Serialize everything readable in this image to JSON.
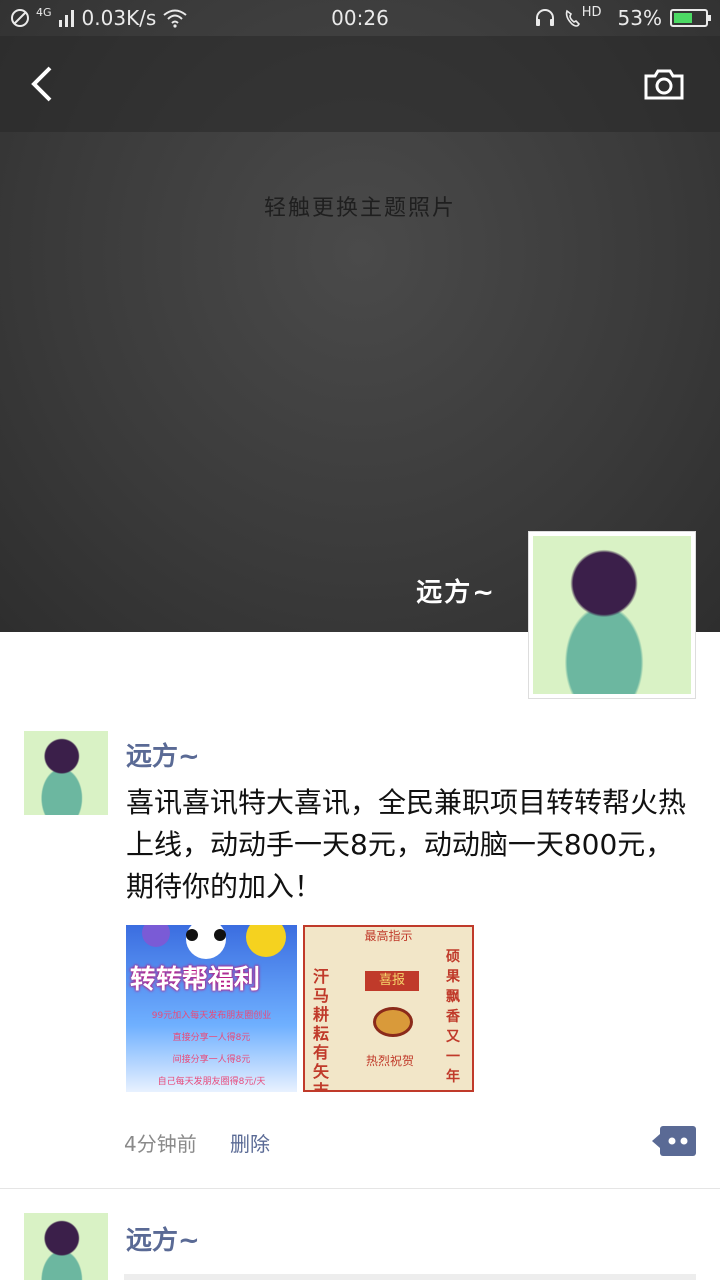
{
  "status_bar": {
    "network_type": "4G",
    "speed": "0.03K/s",
    "time": "00:26",
    "hd_label": "HD",
    "battery_percent": "53%",
    "battery_level": 0.53
  },
  "cover": {
    "hint": "轻触更换主题照片",
    "user_name": "远方~"
  },
  "posts": [
    {
      "user_name": "远方~",
      "text": "喜讯喜讯特大喜讯，全民兼职项目转转帮火热上线，动动手一天8元，动动脑一天800元，期待你的加入！",
      "time_ago": "4分钟前",
      "delete_label": "删除",
      "image1": {
        "title": "转转帮福利",
        "lines": [
          "99元加入每天发布朋友圈创业",
          "直接分享一人得8元",
          "间接分享一人得8元",
          "自己每天发朋友圈得8元/天"
        ]
      },
      "image2": {
        "header": "最高指示",
        "left_text": "汗马耕耘有矢志",
        "right_text": "硕果飘香又一年",
        "banner": "喜报",
        "footer": "热烈祝贺"
      }
    },
    {
      "user_name": "远方~"
    }
  ],
  "colors": {
    "link": "#5a6a95",
    "cover_bg": "#3a3a3a",
    "battery_fill": "#4cd964"
  }
}
